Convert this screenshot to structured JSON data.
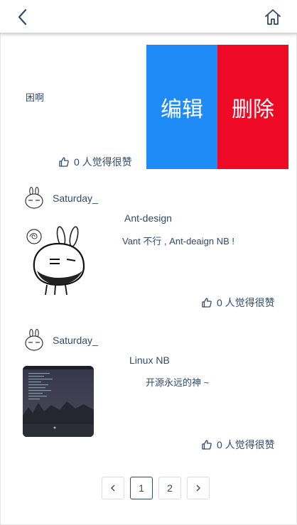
{
  "header": {
    "back_icon": "chevron-left-icon",
    "home_icon": "home-icon"
  },
  "row1": {
    "text": "困啊",
    "likes": "0 人觉得很赞",
    "edit_label": "编辑",
    "delete_label": "删除",
    "edit_color": "#1f8bf7",
    "delete_color": "#ee0a24"
  },
  "posts": [
    {
      "username": "Saturday_",
      "title": "Ant-design",
      "content": "Vant 不行 , Ant-deaign NB !",
      "likes": "0 人觉得很赞"
    },
    {
      "username": "Saturday_",
      "title": "Linux NB",
      "content": "开源永远的神 ~",
      "likes": "0 人觉得很赞"
    }
  ],
  "pagination": {
    "prev_icon": "chevron-left-icon",
    "pages": [
      "1",
      "2"
    ],
    "current": "1",
    "next_icon": "chevron-right-icon"
  }
}
